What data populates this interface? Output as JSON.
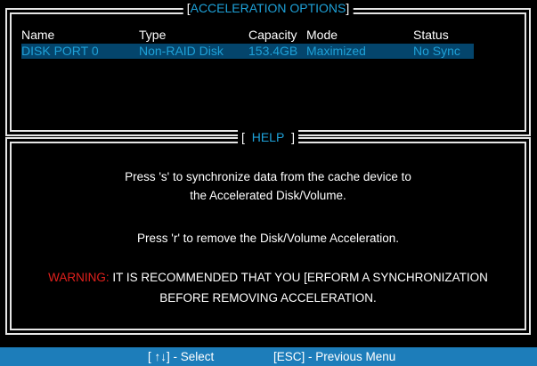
{
  "top_panel": {
    "title": "ACCELERATION OPTIONS",
    "headers": {
      "name": "Name",
      "type": "Type",
      "capacity": "Capacity",
      "mode": "Mode",
      "status": "Status"
    },
    "rows": [
      {
        "name": "DISK PORT 0",
        "type": "Non-RAID Disk",
        "capacity": "153.4GB",
        "mode": "Maximized",
        "status": "No Sync"
      }
    ]
  },
  "help_panel": {
    "title": "HELP",
    "line1": "Press 's' to synchronize data from the cache device to",
    "line2": "the Accelerated Disk/Volume.",
    "line3": "Press 'r' to remove the Disk/Volume Acceleration.",
    "warning_label": "WARNING:",
    "warning_text": " IT IS RECOMMENDED THAT YOU [ERFORM A SYNCHRONIZATION",
    "line5": "BEFORE REMOVING ACCELERATION."
  },
  "footer": {
    "select_hint": "[ ↑↓] - Select",
    "esc_hint": "[ESC] - Previous Menu"
  },
  "colors": {
    "accent": "#1ea1d8",
    "highlight_row": "#04456c",
    "footer_bg": "#1d7dba",
    "warning": "#e0201c"
  }
}
